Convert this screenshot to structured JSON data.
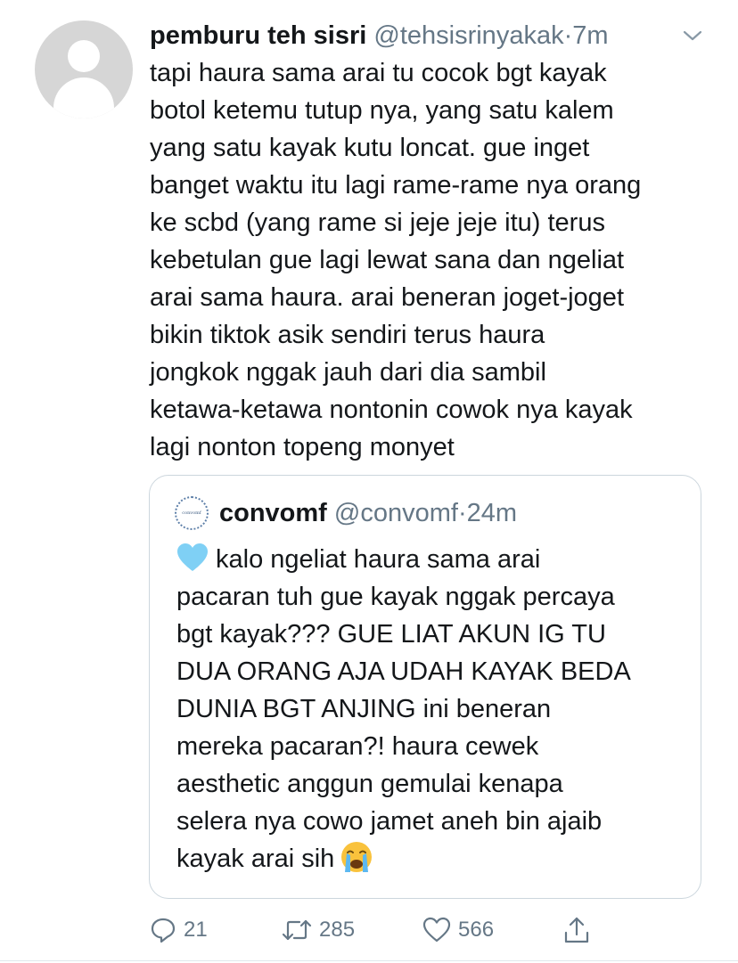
{
  "tweet": {
    "author": {
      "display_name": "pemburu teh sisri",
      "handle": "@tehsisrinyakak",
      "separator": "·",
      "time": "7m",
      "avatar_icon": "default-user-avatar"
    },
    "text_lines": [
      "tapi haura sama arai tu cocok bgt kayak",
      "botol ketemu tutup nya, yang satu kalem",
      "yang satu kayak kutu loncat. gue inget",
      "banget waktu itu lagi rame-rame nya orang",
      "ke scbd (yang rame si jeje jeje itu) terus",
      "kebetulan gue lagi lewat sana dan ngeliat",
      "arai sama haura. arai beneran joget-joget",
      "bikin tiktok asik sendiri terus haura",
      "jongkok nggak jauh dari dia sambil",
      "ketawa-ketawa nontonin cowok nya kayak",
      "lagi nonton topeng monyet"
    ],
    "quoted": {
      "display_name": "convomf",
      "handle": "@convomf",
      "separator": "·",
      "time": "24m",
      "avatar_text": "convomf",
      "text_lines": [
        "kalo ngeliat haura sama arai",
        "pacaran tuh gue kayak nggak percaya",
        "bgt kayak??? GUE LIAT AKUN IG TU",
        "DUA ORANG AJA UDAH KAYAK BEDA",
        "DUNIA BGT ANJING ini beneran",
        "mereka pacaran?! haura cewek",
        "aesthetic anggun gemulai kenapa",
        "selera nya cowo jamet aneh bin ajaib",
        "kayak arai sih"
      ],
      "leading_emoji": "light-blue-heart",
      "trailing_emoji": "loudly-crying-face"
    },
    "actions": {
      "reply_count": "21",
      "retweet_count": "285",
      "like_count": "566"
    }
  },
  "colors": {
    "text_primary": "#14171a",
    "text_secondary": "#657786",
    "border": "#ccd6dd",
    "heart_emoji": "#7fd0f5",
    "cry_emoji": "#f9c23c",
    "tears": "#5cb8f0"
  }
}
